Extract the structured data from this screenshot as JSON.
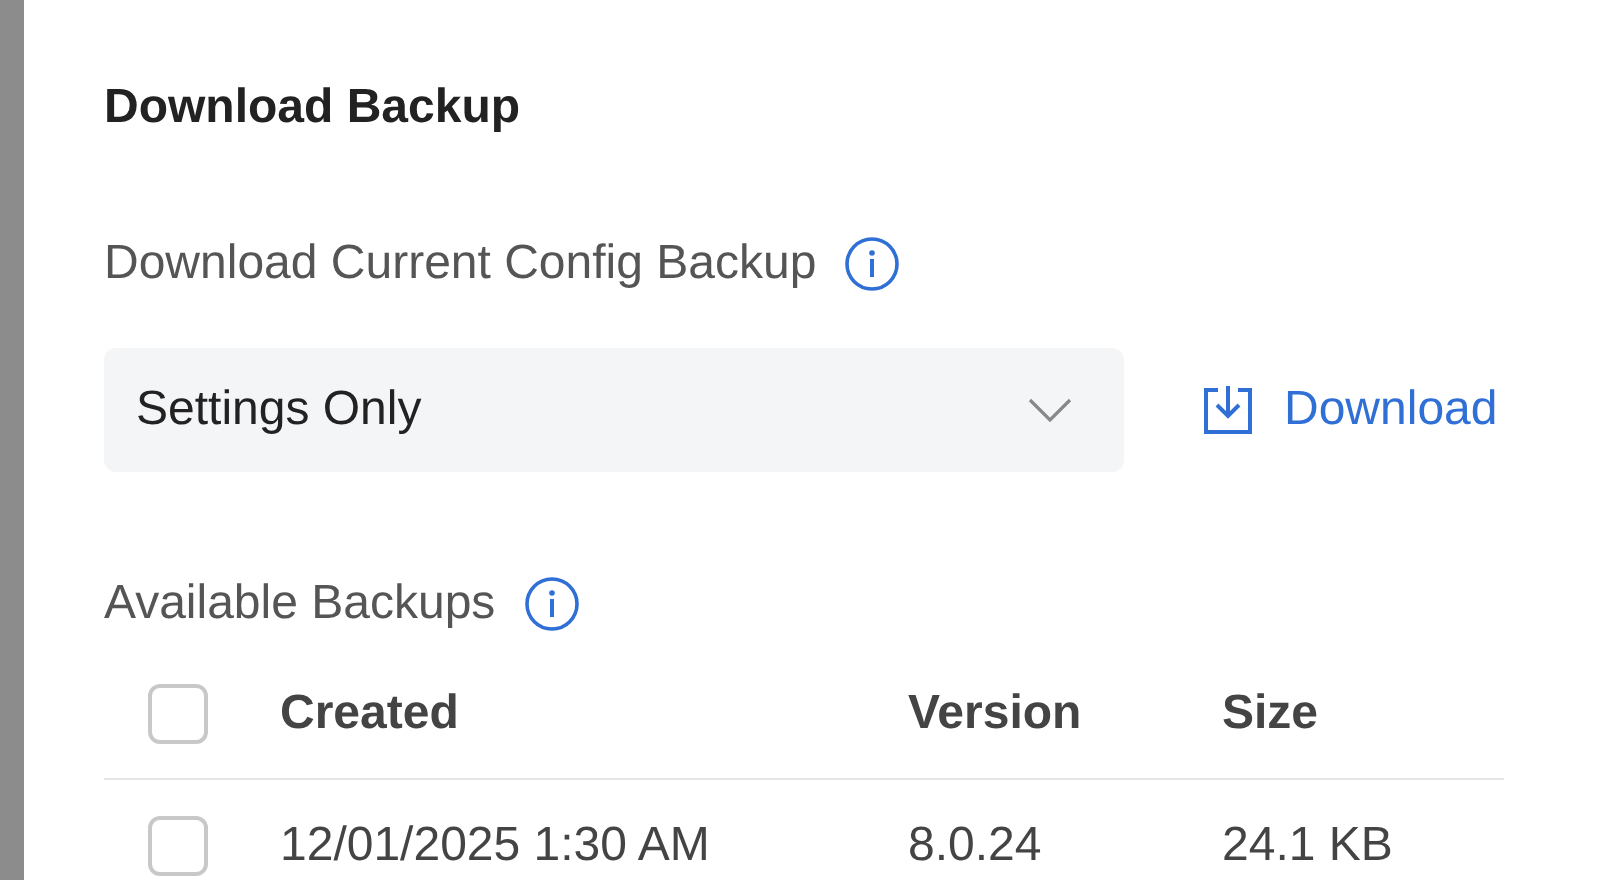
{
  "dialog": {
    "title": "Download Backup",
    "current_label": "Download Current Config Backup",
    "select": {
      "value": "Settings Only"
    },
    "download_button": "Download",
    "available_label": "Available Backups",
    "table": {
      "columns": [
        "Created",
        "Version",
        "Size"
      ],
      "header_checked": false,
      "rows": [
        {
          "checked": false,
          "cells": [
            "12/01/2025 1:30 AM",
            "8.0.24",
            "24.1 KB"
          ]
        }
      ]
    }
  }
}
